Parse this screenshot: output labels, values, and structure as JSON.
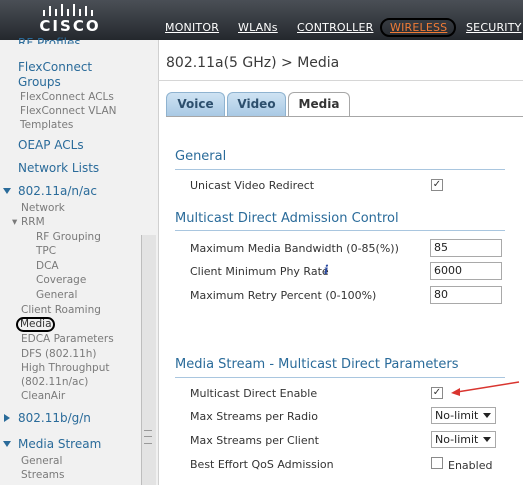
{
  "header": {
    "logo_text": "CISCO",
    "nav": [
      "MONITOR",
      "WLANs",
      "CONTROLLER",
      "WIRELESS",
      "SECURITY"
    ],
    "active": "WIRELESS",
    "accent": "#f07b36"
  },
  "sidebar": {
    "items": {
      "rf_profiles": "RF Profiles",
      "flexconnect_groups_1": "FlexConnect",
      "flexconnect_groups_2": "Groups",
      "flexconnect_acls": "FlexConnect ACLs",
      "flexconnect_vlan_1": "FlexConnect VLAN",
      "flexconnect_vlan_2": "Templates",
      "oeap_acls": "OEAP ACLs",
      "network_lists": "Network Lists",
      "band_a": "802.11a/n/ac",
      "network": "Network",
      "rrm": "RRM",
      "rf_grouping": "RF Grouping",
      "tpc": "TPC",
      "dca": "DCA",
      "coverage": "Coverage",
      "general": "General",
      "client_roaming": "Client Roaming",
      "media": "Media",
      "edca": "EDCA Parameters",
      "dfs": "DFS (802.11h)",
      "high_throughput_1": "High Throughput",
      "high_throughput_2": "(802.11n/ac)",
      "cleanair": "CleanAir",
      "band_b": "802.11b/g/n",
      "media_stream": "Media Stream",
      "ms_general": "General",
      "ms_streams": "Streams"
    }
  },
  "main": {
    "title": "802.11a(5 GHz) > Media",
    "tabs": [
      "Voice",
      "Video",
      "Media"
    ],
    "active_tab": "Media",
    "general": {
      "heading": "General",
      "unicast_label": "Unicast Video Redirect",
      "unicast_checked": true
    },
    "mdac": {
      "heading": "Multicast Direct Admission Control",
      "max_bw_label": "Maximum Media Bandwidth (0-85(%))",
      "max_bw_value": "85",
      "min_phy_label": "Client Minimum Phy Rate",
      "min_phy_value": "6000",
      "retry_label": "Maximum Retry Percent (0-100%)",
      "retry_value": "80"
    },
    "mdp": {
      "heading": "Media Stream - Multicast Direct Parameters",
      "mc_enable_label": "Multicast Direct Enable",
      "mc_enable_checked": true,
      "per_radio_label": "Max Streams per Radio",
      "per_radio_value": "No-limit",
      "per_client_label": "Max Streams per Client",
      "per_client_value": "No-limit",
      "best_effort_label": "Best Effort QoS Admission",
      "best_effort_text": "Enabled",
      "best_effort_checked": false
    }
  }
}
